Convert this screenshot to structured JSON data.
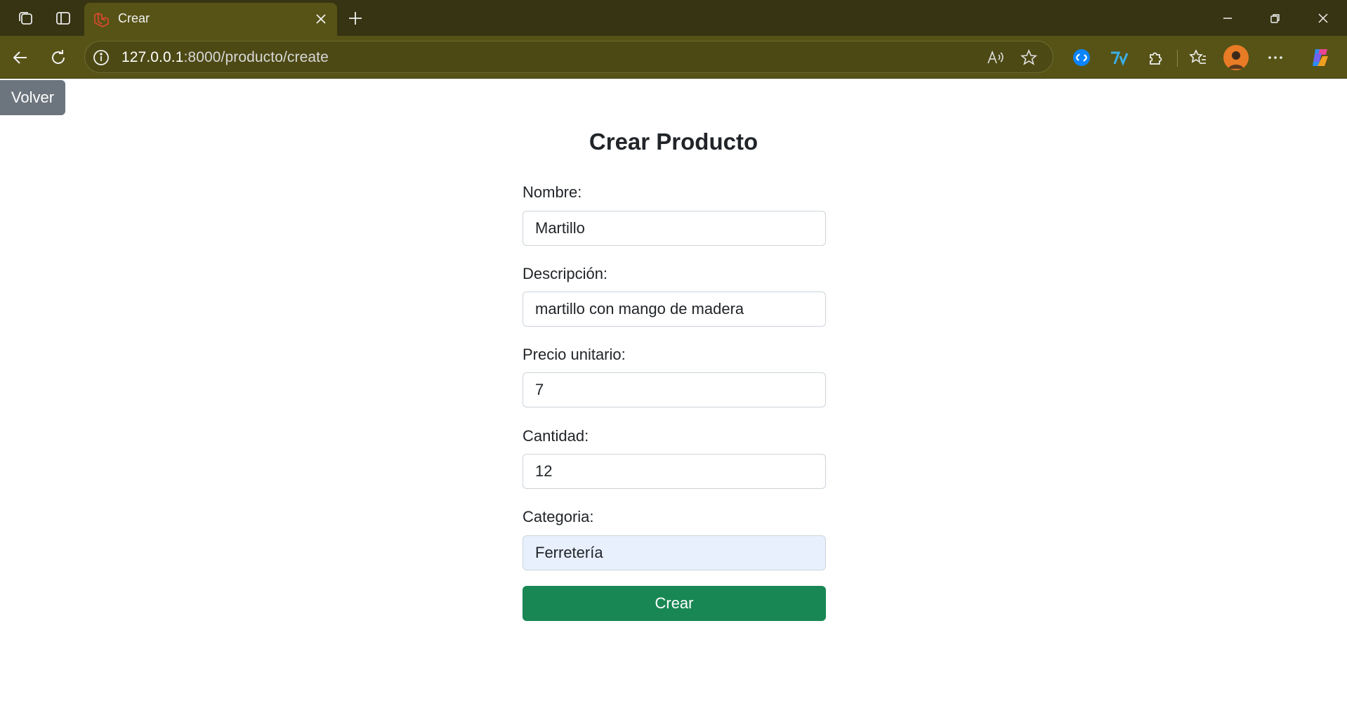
{
  "browser": {
    "tab_title": "Crear",
    "url_host": "127.0.0.1",
    "url_path": ":8000/producto/create"
  },
  "page": {
    "back_label": "Volver",
    "title": "Crear Producto",
    "fields": [
      {
        "label": "Nombre:",
        "value": "Martillo"
      },
      {
        "label": "Descripción:",
        "value": "martillo con mango de madera"
      },
      {
        "label": "Precio unitario:",
        "value": "7"
      },
      {
        "label": "Cantidad:",
        "value": "12"
      },
      {
        "label": "Categoria:",
        "value": "Ferretería"
      }
    ],
    "submit_label": "Crear"
  },
  "colors": {
    "chrome_dark": "#373413",
    "chrome": "#575316",
    "back_button": "#6c757d",
    "submit_button": "#198754",
    "select_bg": "#e8f0fe"
  }
}
